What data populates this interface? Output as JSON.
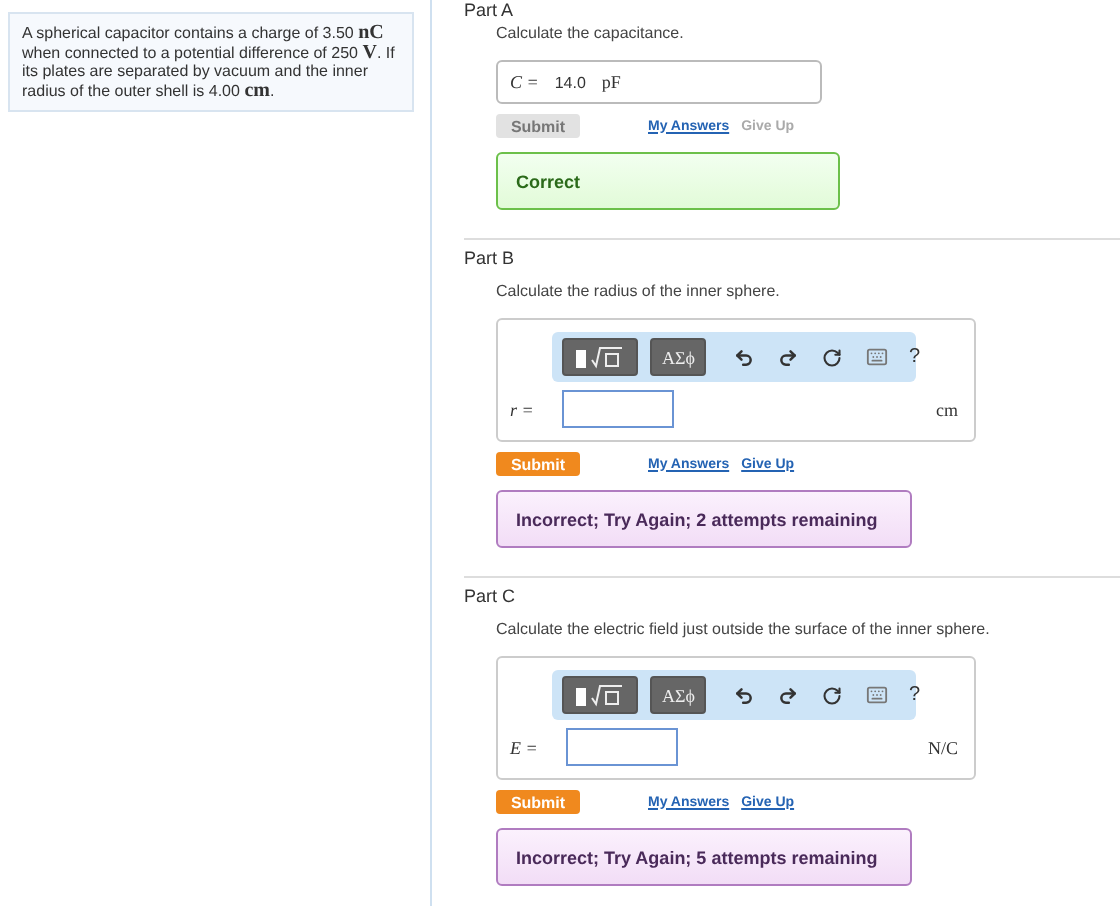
{
  "problem": {
    "segments": [
      {
        "kind": "text",
        "text": "A spherical capacitor contains a charge of 3.50 "
      },
      {
        "kind": "unit",
        "text": "nC"
      },
      {
        "kind": "text",
        "text": " when connected to a potential difference of 250 "
      },
      {
        "kind": "unit",
        "text": "V"
      },
      {
        "kind": "text",
        "text": ". If its plates are separated by vacuum and the inner radius of the outer shell is 4.00 "
      },
      {
        "kind": "unit",
        "text": "cm"
      },
      {
        "kind": "text",
        "text": "."
      }
    ]
  },
  "parts": [
    {
      "label": "Part A",
      "prompt": "Calculate the capacitance.",
      "kind": "answered",
      "variable": "C =",
      "value": "14.0",
      "unit": "pF",
      "submit": {
        "label": "Submit",
        "disabled": true
      },
      "links": [
        {
          "label": "My Answers",
          "disabled": false
        },
        {
          "label": "Give Up",
          "disabled": true
        }
      ],
      "feedback": {
        "kind": "correct",
        "text": "Correct"
      }
    },
    {
      "label": "Part B",
      "prompt": "Calculate the radius of the inner sphere.",
      "kind": "editor",
      "toolbar": {
        "symbols": "ΑΣϕ",
        "help": "?"
      },
      "variable": "r =",
      "unit": "cm",
      "submit": {
        "label": "Submit",
        "disabled": false
      },
      "links": [
        {
          "label": "My Answers",
          "disabled": false
        },
        {
          "label": "Give Up",
          "disabled": false
        }
      ],
      "feedback": {
        "kind": "incorrect",
        "text": "Incorrect; Try Again; 2 attempts remaining"
      }
    },
    {
      "label": "Part C",
      "prompt": "Calculate the electric field just outside the surface of the inner sphere.",
      "kind": "editor",
      "toolbar": {
        "symbols": "ΑΣϕ",
        "help": "?"
      },
      "variable": "E =",
      "unit": "N/C",
      "submit": {
        "label": "Submit",
        "disabled": false
      },
      "links": [
        {
          "label": "My Answers",
          "disabled": false
        },
        {
          "label": "Give Up",
          "disabled": false
        }
      ],
      "feedback": {
        "kind": "incorrect",
        "text": "Incorrect; Try Again; 5 attempts remaining"
      }
    }
  ]
}
